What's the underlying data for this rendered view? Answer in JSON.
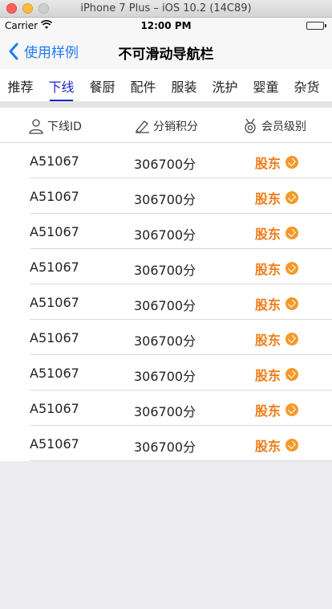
{
  "simulator": {
    "title": "iPhone 7 Plus – iOS 10.2 (14C89)"
  },
  "status_bar": {
    "carrier": "Carrier",
    "time": "12:00 PM"
  },
  "nav": {
    "back_label": "使用样例",
    "title": "不可滑动导航栏"
  },
  "tabs": [
    {
      "label": "推荐"
    },
    {
      "label": "下线"
    },
    {
      "label": "餐厨"
    },
    {
      "label": "配件"
    },
    {
      "label": "服装"
    },
    {
      "label": "洗护"
    },
    {
      "label": "婴童"
    },
    {
      "label": "杂货"
    }
  ],
  "active_tab": 1,
  "table": {
    "headers": {
      "id": "下线ID",
      "points": "分销积分",
      "level": "会员级别"
    },
    "rows": [
      {
        "id": "A51067",
        "points": "306700分",
        "level": "股东"
      },
      {
        "id": "A51067",
        "points": "306700分",
        "level": "股东"
      },
      {
        "id": "A51067",
        "points": "306700分",
        "level": "股东"
      },
      {
        "id": "A51067",
        "points": "306700分",
        "level": "股东"
      },
      {
        "id": "A51067",
        "points": "306700分",
        "level": "股东"
      },
      {
        "id": "A51067",
        "points": "306700分",
        "level": "股东"
      },
      {
        "id": "A51067",
        "points": "306700分",
        "level": "股东"
      },
      {
        "id": "A51067",
        "points": "306700分",
        "level": "股东"
      },
      {
        "id": "A51067",
        "points": "306700分",
        "level": "股东"
      }
    ]
  },
  "colors": {
    "accent": "#1a26c4",
    "back": "#1e7cf0",
    "level": "#f07a16"
  },
  "icons": {
    "back": "chevron-left-icon",
    "user": "user-icon",
    "points": "pen-icon",
    "level": "medal-icon",
    "badge": "diamond-badge-icon"
  }
}
